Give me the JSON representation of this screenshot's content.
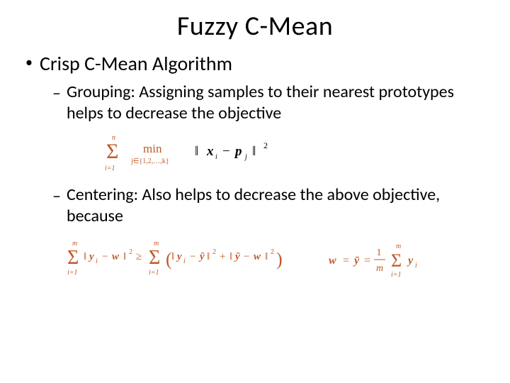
{
  "title": "Fuzzy C-Mean",
  "l1": {
    "bullet": "•",
    "text": "Crisp C-Mean Algorithm"
  },
  "l2a": {
    "bullet": "–",
    "text": "Grouping: Assigning samples to their nearest prototypes helps to decrease the objective"
  },
  "l2b": {
    "bullet": "–",
    "text": "Centering: Also helps to decrease the above objective, because"
  },
  "eq1": {
    "sum_upper": "n",
    "sum_lower": "i=1",
    "min": "min",
    "min_sub": "j∈{1,2,…,k}",
    "expr": "‖ xᵢ − pⱼ ‖²"
  },
  "eq2": {
    "left_sum_upper": "m",
    "left_sum_lower": "i=1",
    "left_inner": "‖ yᵢ − w ‖² ≥",
    "right_sum_upper": "m",
    "right_sum_lower": "i=1",
    "right_inner": "(‖ yᵢ − ȳ ‖² + ‖ ȳ − w ‖²)"
  },
  "eq3": {
    "lhs": "w = ȳ =",
    "frac_top": "1",
    "frac_bot": "m",
    "sum_upper": "m",
    "sum_lower": "i=1",
    "rhs": "yᵢ"
  }
}
